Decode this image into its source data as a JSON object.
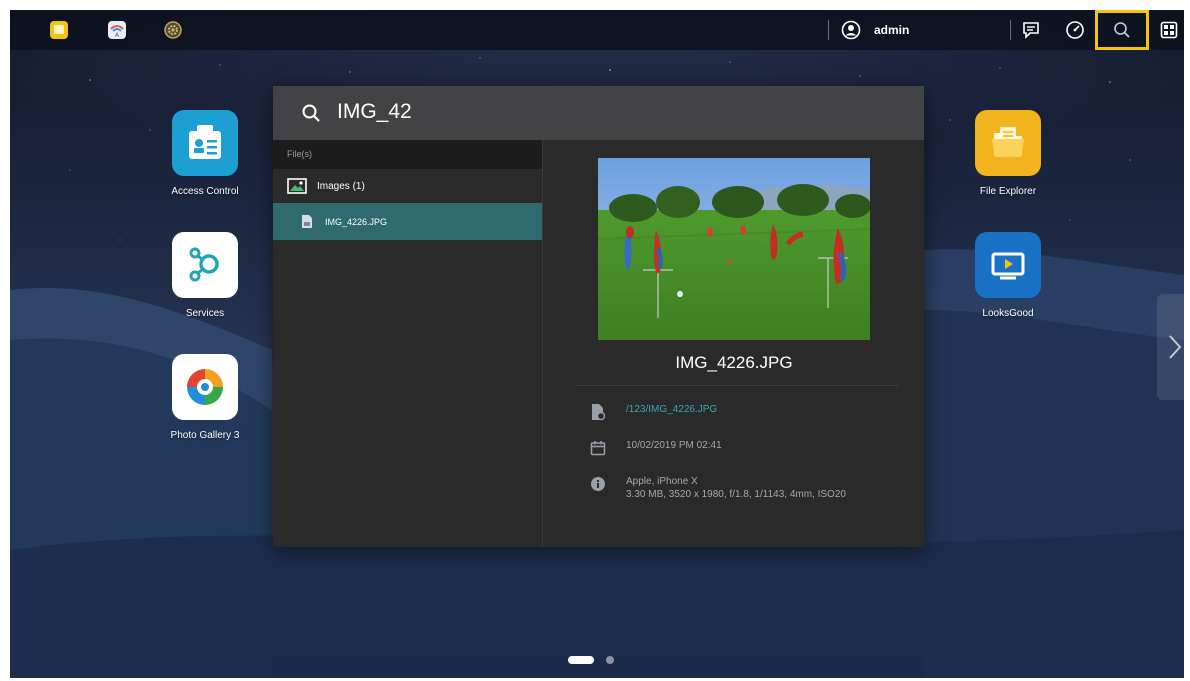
{
  "taskbar": {
    "user_name": "admin",
    "icons": [
      "file-manager-icon",
      "app-center-icon",
      "settings-icon",
      "user-icon",
      "notes-icon",
      "dashboard-icon",
      "search-icon",
      "desktop-icon"
    ]
  },
  "desktop": {
    "left_apps": [
      {
        "label": "Access Control",
        "icon": "access-control-icon"
      },
      {
        "label": "Services",
        "icon": "services-icon"
      },
      {
        "label": "Photo Gallery 3",
        "icon": "photo-gallery-icon"
      }
    ],
    "right_apps": [
      {
        "label": "File Explorer",
        "icon": "file-explorer-icon"
      },
      {
        "label": "LooksGood",
        "icon": "looksgood-icon"
      }
    ],
    "pages": {
      "current": 1,
      "total": 2
    }
  },
  "search": {
    "query": "IMG_42",
    "section_title": "File(s)",
    "group_label": "Images (1)",
    "result_name": "IMG_4226.JPG",
    "preview": {
      "title": "IMG_4226.JPG",
      "path": "/123/IMG_4226.JPG",
      "date": "10/02/2019 PM 02:41",
      "camera": "Apple, iPhone X",
      "details": "3.30 MB, 3520 x 1980, f/1.8, 1/1143, 4mm, ISO20"
    }
  },
  "colors": {
    "highlight": "#f5c311",
    "selected_row": "#2e6a6e",
    "link": "#3aa7b0",
    "panel": "#2a2a2b"
  }
}
